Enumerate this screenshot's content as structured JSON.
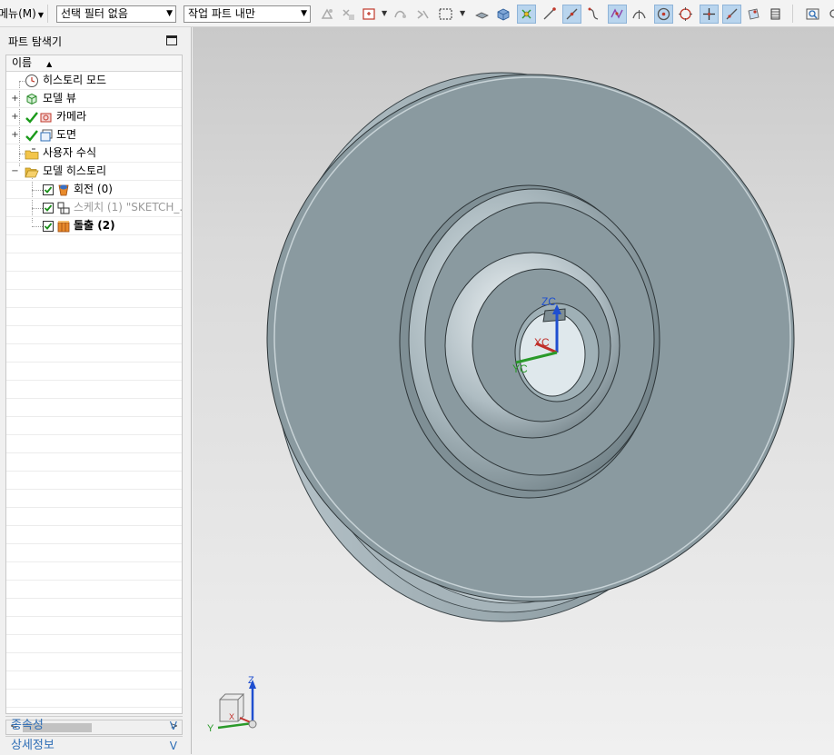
{
  "toolbar": {
    "menu_label": "메뉴(M)",
    "select_filter": "선택 필터 없음",
    "select_scope": "작업 파트 내만"
  },
  "panel": {
    "title": "파트 탐색기",
    "column_header": "이름",
    "tree": [
      {
        "label": "히스토리 모드",
        "icon": "clock-icon"
      },
      {
        "label": "모델 뷰",
        "icon": "model-view-icon"
      },
      {
        "label": "카메라",
        "icon": "camera-icon"
      },
      {
        "label": "도면",
        "icon": "drawing-icon"
      },
      {
        "label": "사용자 수식",
        "icon": "folder-expression-icon"
      },
      {
        "label": "모델 히스토리",
        "icon": "folder-open-icon"
      },
      {
        "label": "회전 (0)",
        "icon": "revolve-icon"
      },
      {
        "label": "스케치 (1) \"SKETCH_...",
        "icon": "sketch-icon"
      },
      {
        "label": "돌출 (2)",
        "icon": "extrude-icon"
      }
    ],
    "sections": [
      {
        "label": "종속성"
      },
      {
        "label": "상세정보"
      }
    ]
  },
  "viewport": {
    "csys_labels": {
      "zc": "ZC",
      "xc": "XC",
      "yc": "YC"
    },
    "triad_labels": {
      "z": "Z",
      "y": "Y",
      "x": "X"
    }
  },
  "colors": {
    "part_face": "#8a9aa0",
    "accent_blue": "#2d6db5",
    "check_green": "#1a8f1a"
  }
}
